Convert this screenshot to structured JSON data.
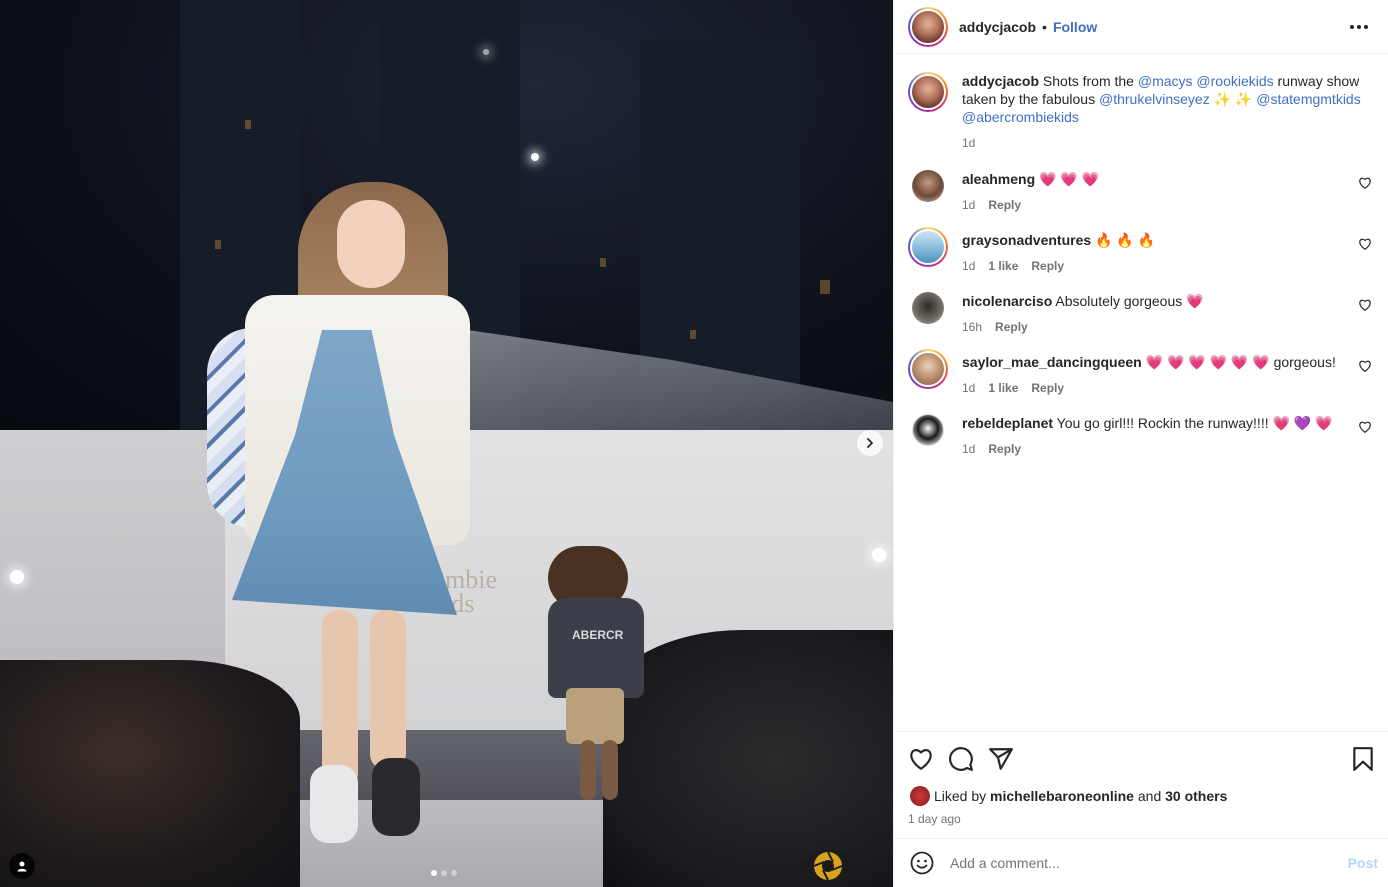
{
  "post": {
    "username": "addycjacob",
    "follow_label": "Follow",
    "separator": "•"
  },
  "media": {
    "overlay_text_line1": "ombie",
    "overlay_text_line2": "ids",
    "boy_shirt_text": "ABERCR",
    "carousel": {
      "count": 3,
      "active_index": 0
    },
    "icons": {
      "next": "chevron-right-icon",
      "tag": "user-tag-icon",
      "watermark": "camera-eye-logo"
    }
  },
  "caption": {
    "username": "addycjacob",
    "text_1": " Shots from the ",
    "mention_1": "@macys",
    "mention_2": "@rookiekids",
    "text_2": " runway show taken by the fabulous ",
    "mention_3": "@thrukelvinseyez",
    "emoji": " ✨ ✨ ",
    "mention_4": "@statemgmtkids",
    "mention_5": "@abercrombiekids",
    "time": "1d"
  },
  "comments": [
    {
      "username": "aleahmeng",
      "text": "💗 💗 💗",
      "time": "1d",
      "likes": "",
      "reply": "Reply"
    },
    {
      "username": "graysonadventures",
      "text": "🔥 🔥 🔥",
      "time": "1d",
      "likes": "1 like",
      "reply": "Reply"
    },
    {
      "username": "nicolenarciso",
      "text": "Absolutely gorgeous 💗",
      "time": "16h",
      "likes": "",
      "reply": "Reply"
    },
    {
      "username": "saylor_mae_dancingqueen",
      "text": "💗 💗 💗 💗 💗 💗  gorgeous!",
      "time": "1d",
      "likes": "1 like",
      "reply": "Reply"
    },
    {
      "username": "rebeldeplanet",
      "text": "You go girl!!! Rockin the runway!!!! 💗 💜 💗",
      "time": "1d",
      "likes": "",
      "reply": "Reply"
    }
  ],
  "likes": {
    "prefix": "Liked by ",
    "user": "michellebaroneonline",
    "middle": " and ",
    "others": "30 others",
    "time_ago": "1 day ago"
  },
  "add_comment": {
    "placeholder": "Add a comment...",
    "post_label": "Post"
  },
  "colors": {
    "link": "#3f6fc6",
    "muted": "#737373",
    "text": "#262626",
    "post_disabled": "#b3d4fc"
  }
}
